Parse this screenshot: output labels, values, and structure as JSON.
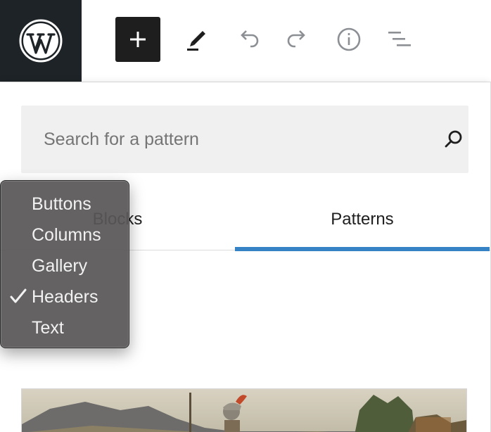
{
  "toolbar": {
    "logo_icon": "wordpress-icon",
    "add_icon": "plus-icon",
    "edit_icon": "pencil-icon",
    "undo_icon": "undo-icon",
    "redo_icon": "redo-icon",
    "info_icon": "info-icon",
    "outline_icon": "list-view-icon"
  },
  "inserter": {
    "search": {
      "placeholder": "Search for a pattern",
      "value": ""
    },
    "tabs": [
      {
        "label": "Blocks",
        "active": false
      },
      {
        "label": "Patterns",
        "active": true
      }
    ]
  },
  "category_dropdown": {
    "items": [
      {
        "label": "Buttons",
        "checked": false
      },
      {
        "label": "Columns",
        "checked": false
      },
      {
        "label": "Gallery",
        "checked": false
      },
      {
        "label": "Headers",
        "checked": true
      },
      {
        "label": "Text",
        "checked": false
      }
    ]
  },
  "colors": {
    "toolbar_logo_bg": "#1e2327",
    "add_button_bg": "#1e1e1e",
    "tab_indicator": "#3582c4",
    "search_bg": "#f0f0f0",
    "dropdown_bg": "#585656"
  }
}
